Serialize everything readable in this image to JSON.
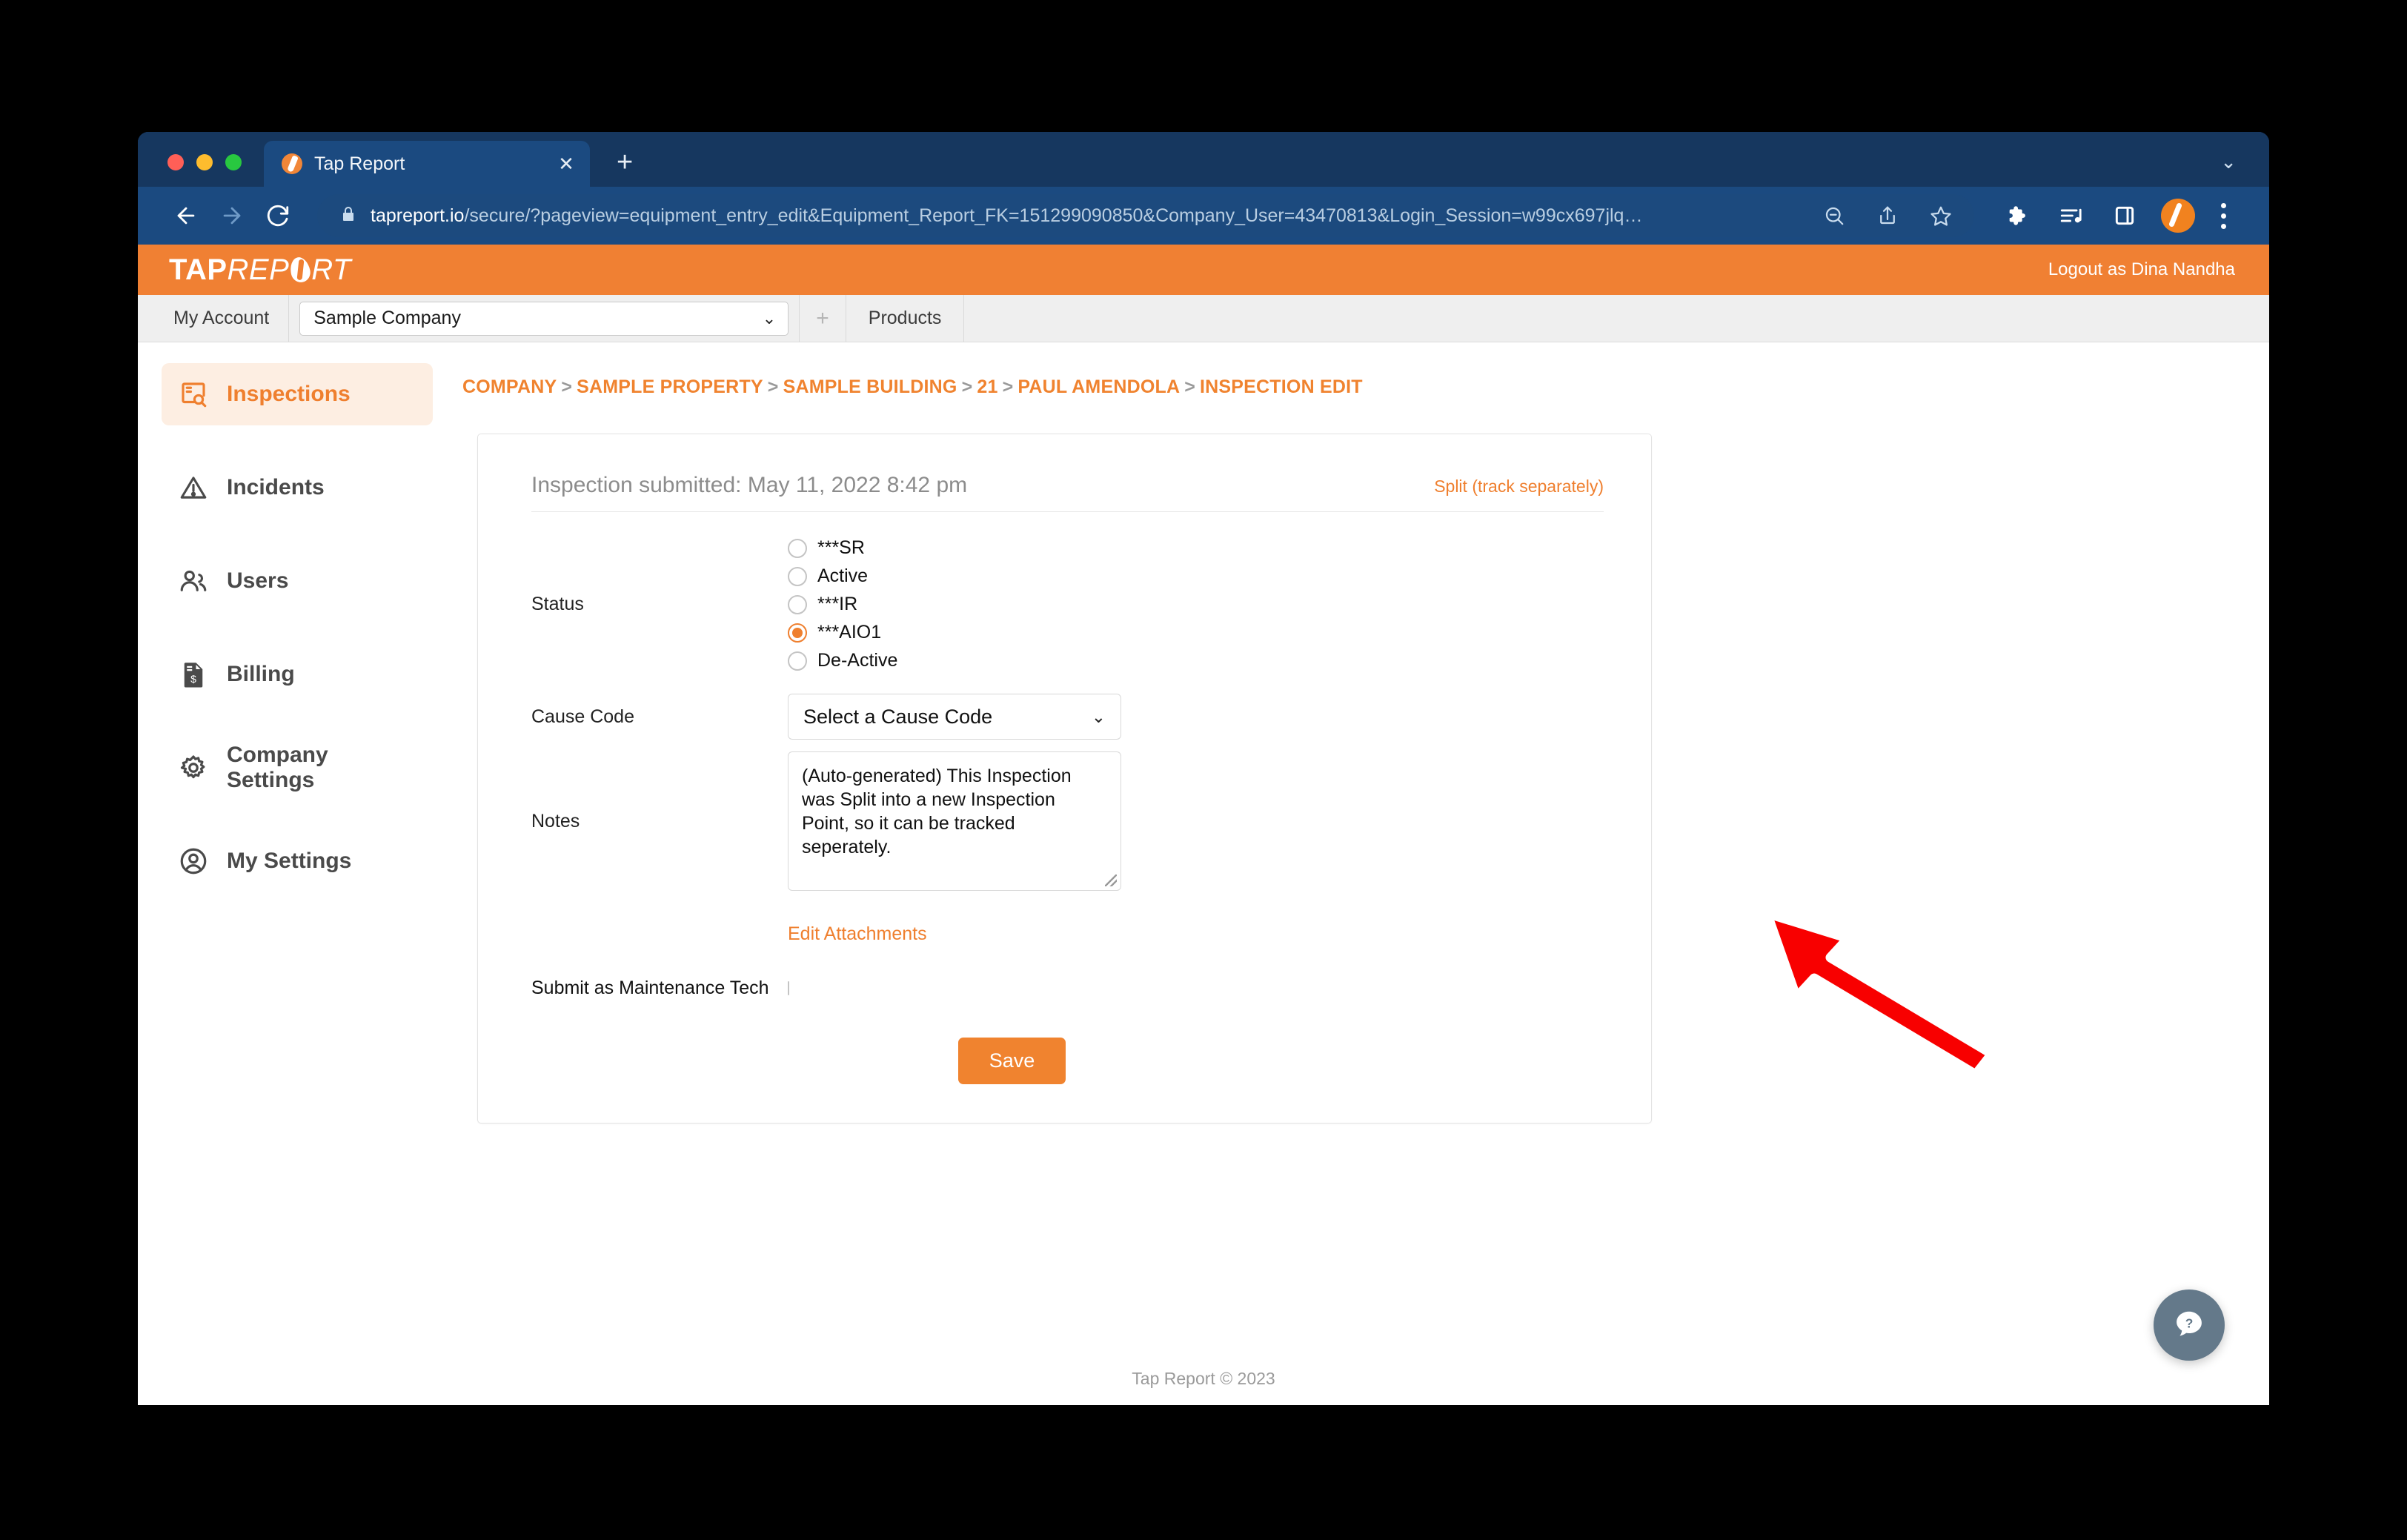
{
  "browser": {
    "tab_title": "Tap Report",
    "tab_favicon": "tapreport-logo-icon",
    "close_label": "✕",
    "new_tab_label": "+",
    "tabstrip_chevron": "⌄",
    "url_host": "tapreport.io",
    "url_path": "/secure/?pageview=equipment_entry_edit&Equipment_Report_FK=151299090850&Company_User=43470813&Login_Session=w99cx697jlq…",
    "back_label": "←",
    "forward_label": "→",
    "reload_label": "⟳",
    "icons": {
      "lock": "lock-icon",
      "zoom_out": "zoom-out-icon",
      "share": "share-icon",
      "bookmark": "star-icon",
      "extensions": "puzzle-icon",
      "media": "media-playlist-icon",
      "side_panel": "side-panel-icon",
      "profile": "profile-avatar-icon",
      "menu": "three-dot-menu-icon"
    }
  },
  "app_header": {
    "logo_part1": "TAP",
    "logo_part2": "REP",
    "logo_part3": "RT",
    "logout_label": "Logout as Dina Nandha"
  },
  "account_bar": {
    "my_account_label": "My Account",
    "company_value": "Sample Company",
    "company_chevron": "⌄",
    "add_label": "+",
    "products_label": "Products"
  },
  "sidebar": {
    "items": [
      {
        "label": "Inspections",
        "icon": "inspections-icon",
        "active": true
      },
      {
        "label": "Incidents",
        "icon": "warning-triangle-icon",
        "active": false
      },
      {
        "label": "Users",
        "icon": "users-icon",
        "active": false
      },
      {
        "label": "Billing",
        "icon": "invoice-dollar-icon",
        "active": false
      },
      {
        "label": "Company Settings",
        "icon": "gear-icon",
        "active": false
      },
      {
        "label": "My Settings",
        "icon": "user-circle-icon",
        "active": false
      }
    ]
  },
  "breadcrumb": {
    "separator": ">",
    "items": [
      "COMPANY",
      "SAMPLE PROPERTY",
      "SAMPLE BUILDING",
      "21",
      "PAUL AMENDOLA",
      "INSPECTION EDIT"
    ]
  },
  "card": {
    "submitted_text": "Inspection submitted: May 11, 2022 8:42 pm",
    "split_link": "Split (track separately)",
    "status": {
      "label": "Status",
      "options": [
        {
          "label": "***SR",
          "checked": false
        },
        {
          "label": "Active",
          "checked": false
        },
        {
          "label": "***IR",
          "checked": false
        },
        {
          "label": "***AIO1",
          "checked": true
        },
        {
          "label": "De-Active",
          "checked": false
        }
      ]
    },
    "cause_code": {
      "label": "Cause Code",
      "value": "Select a Cause Code",
      "chevron": "⌄"
    },
    "notes": {
      "label": "Notes",
      "value": "(Auto-generated) This Inspection was Split into a new Inspection Point, so it can be tracked seperately."
    },
    "edit_attachments_link": "Edit Attachments",
    "maintenance": {
      "label": "Submit as Maintenance Tech",
      "checked": false
    },
    "save_label": "Save"
  },
  "footer": {
    "text": "Tap Report © 2023"
  },
  "help": {
    "icon": "help-question-bubble-icon"
  },
  "annotation": {
    "type": "red-arrow",
    "color": "#f80000",
    "points_to": "Split (track separately)"
  },
  "colors": {
    "brand_orange": "#f08033",
    "accent_orange": "#ef7f2e",
    "browser_blue": "#1b4a80",
    "annotation_red": "#f80000"
  }
}
